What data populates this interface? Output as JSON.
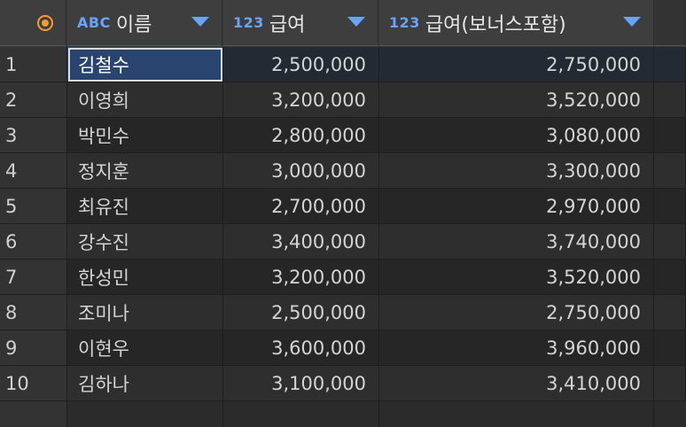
{
  "header": {
    "columns": [
      {
        "type_badge": "ABC",
        "label": "이름"
      },
      {
        "type_badge": "123",
        "label": "급여"
      },
      {
        "type_badge": "123",
        "label": "급여(보너스포함)"
      }
    ]
  },
  "rows": [
    {
      "num": "1",
      "name": "김철수",
      "salary": "2,500,000",
      "bonus": "2,750,000"
    },
    {
      "num": "2",
      "name": "이영희",
      "salary": "3,200,000",
      "bonus": "3,520,000"
    },
    {
      "num": "3",
      "name": "박민수",
      "salary": "2,800,000",
      "bonus": "3,080,000"
    },
    {
      "num": "4",
      "name": "정지훈",
      "salary": "3,000,000",
      "bonus": "3,300,000"
    },
    {
      "num": "5",
      "name": "최유진",
      "salary": "2,700,000",
      "bonus": "2,970,000"
    },
    {
      "num": "6",
      "name": "강수진",
      "salary": "3,400,000",
      "bonus": "3,740,000"
    },
    {
      "num": "7",
      "name": "한성민",
      "salary": "3,200,000",
      "bonus": "3,520,000"
    },
    {
      "num": "8",
      "name": "조미나",
      "salary": "2,500,000",
      "bonus": "2,750,000"
    },
    {
      "num": "9",
      "name": "이현우",
      "salary": "3,600,000",
      "bonus": "3,960,000"
    },
    {
      "num": "10",
      "name": "김하나",
      "salary": "3,100,000",
      "bonus": "3,410,000"
    }
  ],
  "colors": {
    "accent": "#6aa3ff",
    "corner_icon": "#f39c34",
    "selection": "#2a4470"
  },
  "icons": {
    "corner": "record-icon",
    "sort": "triangle-down-icon"
  }
}
